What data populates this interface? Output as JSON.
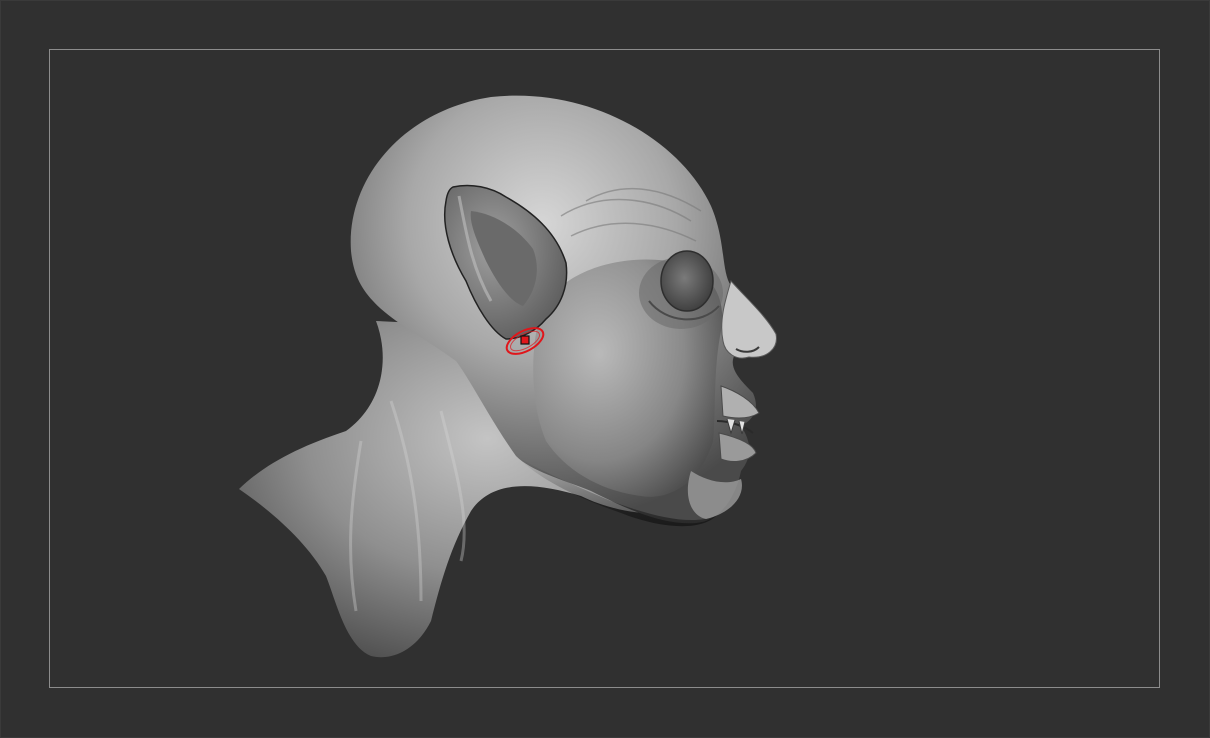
{
  "viewport": {
    "background_color": "#303030",
    "frame_color": "#8c8c8c"
  },
  "model": {
    "material_base_color": "#8a8a8a",
    "material_highlight_color": "#d8d8d8",
    "material_shadow_color": "#3a3a3a"
  },
  "brush_cursor": {
    "color": "#e0161b",
    "icon": "brush-circle-cursor-icon"
  }
}
